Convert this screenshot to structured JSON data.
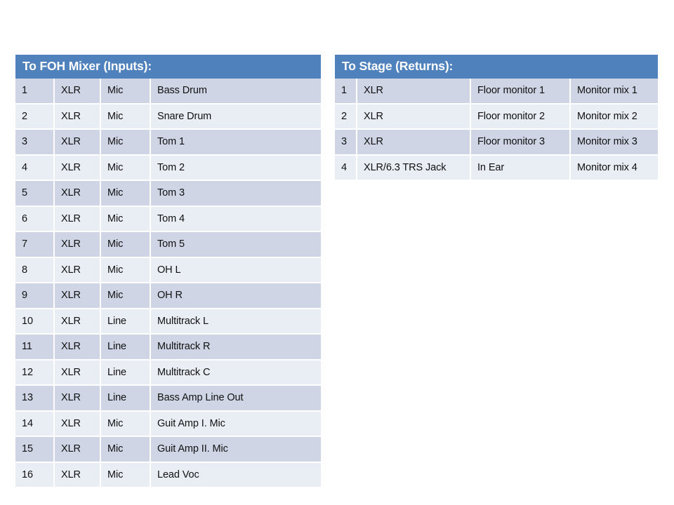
{
  "slide": {
    "background_color": "#FFFFFF",
    "accent_color": "#4F81BD",
    "band_dark_color": "#CFD5E5",
    "band_light_color": "#E9EDF4"
  },
  "foh_table": {
    "title": "To FOH Mixer (Inputs):",
    "rows": [
      {
        "num": "1",
        "connector": "XLR",
        "type": "Mic",
        "source": "Bass Drum"
      },
      {
        "num": "2",
        "connector": "XLR",
        "type": "Mic",
        "source": "Snare Drum"
      },
      {
        "num": "3",
        "connector": "XLR",
        "type": "Mic",
        "source": "Tom 1"
      },
      {
        "num": "4",
        "connector": "XLR",
        "type": "Mic",
        "source": "Tom 2"
      },
      {
        "num": "5",
        "connector": "XLR",
        "type": "Mic",
        "source": "Tom 3"
      },
      {
        "num": "6",
        "connector": "XLR",
        "type": "Mic",
        "source": "Tom 4"
      },
      {
        "num": "7",
        "connector": "XLR",
        "type": "Mic",
        "source": "Tom 5"
      },
      {
        "num": "8",
        "connector": "XLR",
        "type": "Mic",
        "source": "OH L"
      },
      {
        "num": "9",
        "connector": "XLR",
        "type": "Mic",
        "source": "OH R"
      },
      {
        "num": "10",
        "connector": "XLR",
        "type": "Line",
        "source": "Multitrack L"
      },
      {
        "num": "11",
        "connector": "XLR",
        "type": "Line",
        "source": "Multitrack R"
      },
      {
        "num": "12",
        "connector": "XLR",
        "type": "Line",
        "source": "Multitrack C"
      },
      {
        "num": "13",
        "connector": "XLR",
        "type": "Line",
        "source": "Bass Amp Line Out"
      },
      {
        "num": "14",
        "connector": "XLR",
        "type": "Mic",
        "source": "Guit Amp I. Mic"
      },
      {
        "num": "15",
        "connector": "XLR",
        "type": "Mic",
        "source": "Guit Amp II. Mic"
      },
      {
        "num": "16",
        "connector": "XLR",
        "type": "Mic",
        "source": "Lead Voc"
      }
    ]
  },
  "stage_table": {
    "title": "To Stage (Returns):",
    "rows": [
      {
        "num": "1",
        "connector": "XLR",
        "destination": "Floor monitor 1",
        "mix": "Monitor mix 1"
      },
      {
        "num": "2",
        "connector": "XLR",
        "destination": "Floor monitor 2",
        "mix": "Monitor mix 2"
      },
      {
        "num": "3",
        "connector": "XLR",
        "destination": "Floor monitor 3",
        "mix": "Monitor mix 3"
      },
      {
        "num": "4",
        "connector": "XLR/6.3 TRS Jack",
        "destination": "In Ear",
        "mix": "Monitor mix 4"
      }
    ]
  }
}
